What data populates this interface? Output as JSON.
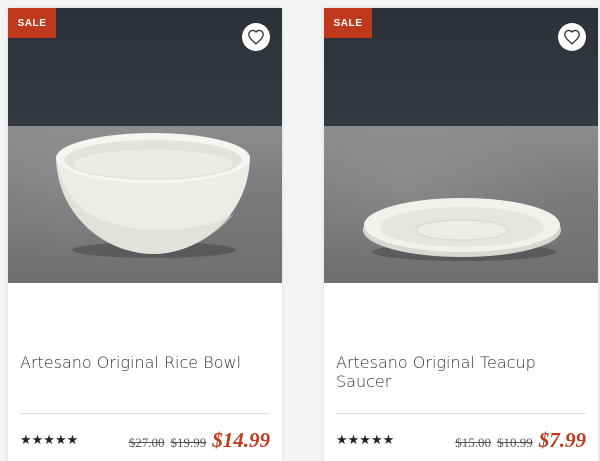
{
  "products": [
    {
      "badge": "SALE",
      "name": "Artesano Original Rice Bowl",
      "stars": "★★★★★",
      "original_price": "$27.00",
      "previous_price": "$19.99",
      "sale_price": "$14.99",
      "image": "rice-bowl-image"
    },
    {
      "badge": "SALE",
      "name": "Artesano Original Teacup Saucer",
      "stars": "★★★★★",
      "original_price": "$15.00",
      "previous_price": "$10.99",
      "sale_price": "$7.99",
      "image": "teacup-saucer-image"
    }
  ],
  "colors": {
    "sale": "#c0391d",
    "wall": "#2f343a",
    "table": "#7e8082"
  },
  "icons": {
    "wishlist": "heart-icon"
  }
}
